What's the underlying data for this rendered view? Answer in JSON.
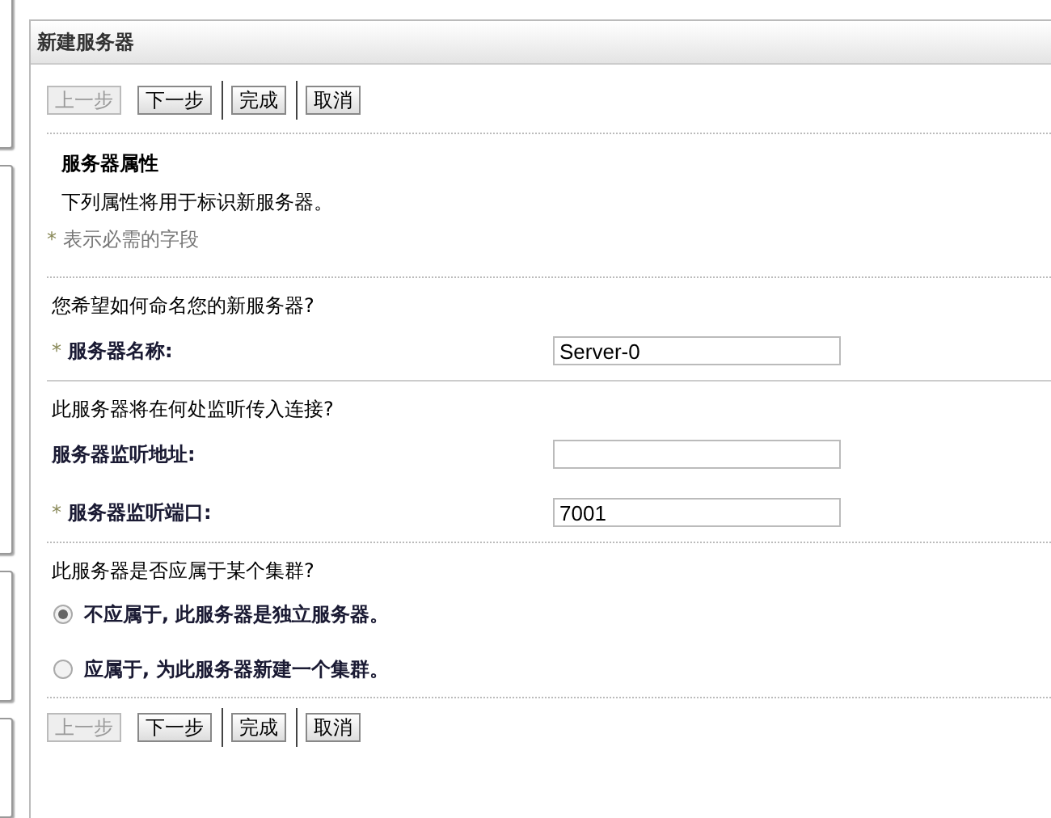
{
  "panel": {
    "title": "新建服务器"
  },
  "buttons_top": [
    {
      "label": "上一步",
      "disabled": true
    },
    {
      "label": "下一步",
      "disabled": false
    },
    {
      "label": "完成",
      "disabled": false
    },
    {
      "label": "取消",
      "disabled": false
    }
  ],
  "section": {
    "heading": "服务器属性",
    "description": "下列属性将用于标识新服务器。",
    "required_note": {
      "mark": "*",
      "text": "表示必需的字段"
    }
  },
  "groups": [
    {
      "question": "您希望如何命名您的新服务器?",
      "fields": [
        {
          "required_mark": "*",
          "label": "服务器名称:",
          "value": "Server-0"
        }
      ]
    },
    {
      "question": "此服务器将在何处监听传入连接?",
      "fields": [
        {
          "label": "服务器监听地址:"
        },
        {
          "required_mark": "*",
          "label": "服务器监听端口:",
          "value": "7001"
        }
      ]
    }
  ],
  "cluster": {
    "question": "此服务器是否应属于某个集群?",
    "options": [
      {
        "label": "不应属于, 此服务器是独立服务器。",
        "selected": true
      },
      {
        "label": "应属于, 为此服务器新建一个集群。",
        "selected": false
      }
    ]
  },
  "buttons_bottom": [
    {
      "label": "上一步",
      "disabled": true
    },
    {
      "label": "下一步",
      "disabled": false
    },
    {
      "label": "完成",
      "disabled": false
    },
    {
      "label": "取消",
      "disabled": false
    }
  ]
}
